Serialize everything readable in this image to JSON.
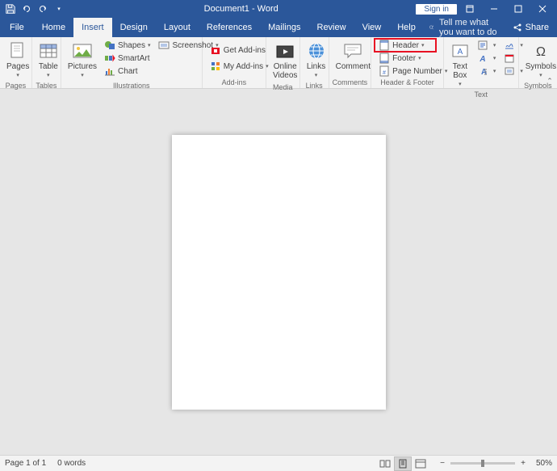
{
  "titlebar": {
    "title": "Document1 - Word",
    "signin": "Sign in"
  },
  "tabs": {
    "file": "File",
    "items": [
      "Home",
      "Insert",
      "Design",
      "Layout",
      "References",
      "Mailings",
      "Review",
      "View",
      "Help"
    ],
    "active": 1,
    "tellme": "Tell me what you want to do",
    "share": "Share"
  },
  "ribbon": {
    "pages": {
      "label": "Pages",
      "btn": "Pages"
    },
    "tables": {
      "label": "Tables",
      "btn": "Table"
    },
    "illustrations": {
      "label": "Illustrations",
      "pictures": "Pictures",
      "shapes": "Shapes",
      "smartart": "SmartArt",
      "chart": "Chart",
      "screenshot": "Screenshot"
    },
    "addins": {
      "label": "Add-ins",
      "get": "Get Add-ins",
      "my": "My Add-ins"
    },
    "media": {
      "label": "Media",
      "online": "Online\nVideos"
    },
    "links": {
      "label": "Links",
      "btn": "Links"
    },
    "comments": {
      "label": "Comments",
      "btn": "Comment"
    },
    "headerfooter": {
      "label": "Header & Footer",
      "header": "Header",
      "footer": "Footer",
      "page": "Page Number"
    },
    "text": {
      "label": "Text",
      "textbox": "Text\nBox"
    },
    "symbols": {
      "label": "Symbols",
      "btn": "Symbols"
    }
  },
  "status": {
    "page": "Page 1 of 1",
    "words": "0 words",
    "zoom": "50%"
  }
}
